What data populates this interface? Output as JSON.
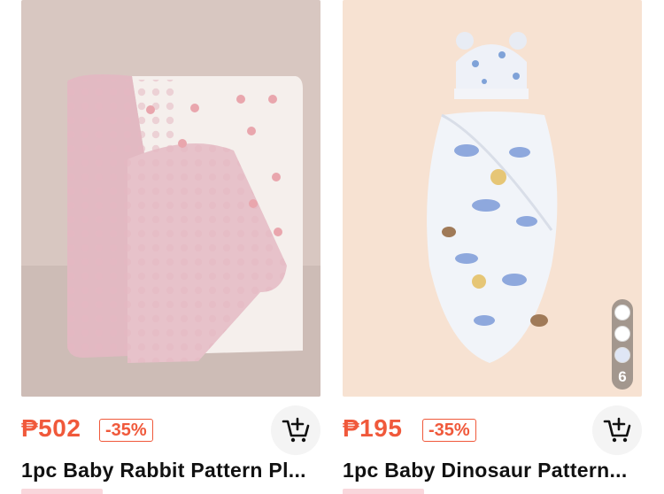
{
  "products": [
    {
      "price": "₱502",
      "discount": "-35%",
      "title": "1pc Baby Rabbit Pattern Pl..."
    },
    {
      "price": "₱195",
      "discount": "-35%",
      "title": "1pc Baby Dinosaur Pattern...",
      "swatch_count": "6"
    }
  ],
  "colors": {
    "price": "#f0593b",
    "image_bg_left": "#d6c5bf",
    "image_bg_right": "#f6e0cf"
  },
  "icons": [
    "add-to-cart-icon"
  ]
}
